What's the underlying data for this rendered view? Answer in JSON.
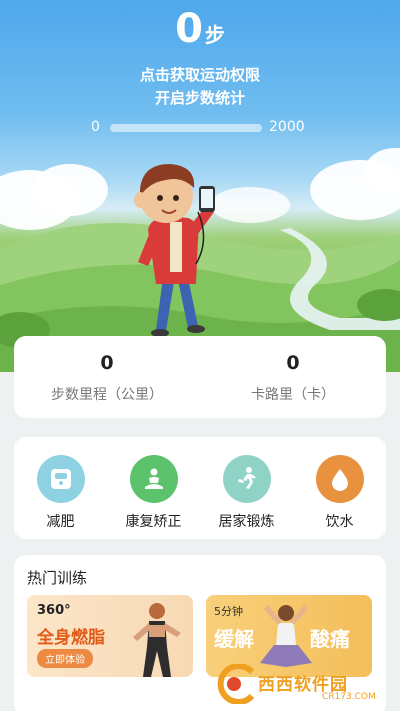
{
  "header": {
    "steps_value": "0",
    "steps_unit": "步",
    "permission_line1": "点击获取运动权限",
    "permission_line2": "开启步数统计",
    "progress": {
      "min": "0",
      "max": "2000",
      "fraction": 0
    }
  },
  "stats": [
    {
      "value": "0",
      "label": "步数里程（公里）"
    },
    {
      "value": "0",
      "label": "卡路里（卡）"
    }
  ],
  "shortcuts": [
    {
      "label": "减肥",
      "icon": "scale-icon",
      "color": "#8ed1e3"
    },
    {
      "label": "康复矫正",
      "icon": "meditation-icon",
      "color": "#5cc26b"
    },
    {
      "label": "居家锻炼",
      "icon": "running-icon",
      "color": "#8fd3c7"
    },
    {
      "label": "饮水",
      "icon": "water-drop-icon",
      "color": "#e8923f"
    }
  ],
  "training": {
    "title": "热门训练",
    "cards": [
      {
        "top_text": "360°",
        "big_text": "全身燃脂",
        "cta": "立即体验",
        "color": "#fbe6c8"
      },
      {
        "top_text": "5分钟",
        "big_text_1": "缓解",
        "big_text_2": "酸痛",
        "color": "#f4be5a"
      }
    ]
  },
  "watermark": {
    "text": "西西软件园",
    "url": "CR173.COM"
  }
}
